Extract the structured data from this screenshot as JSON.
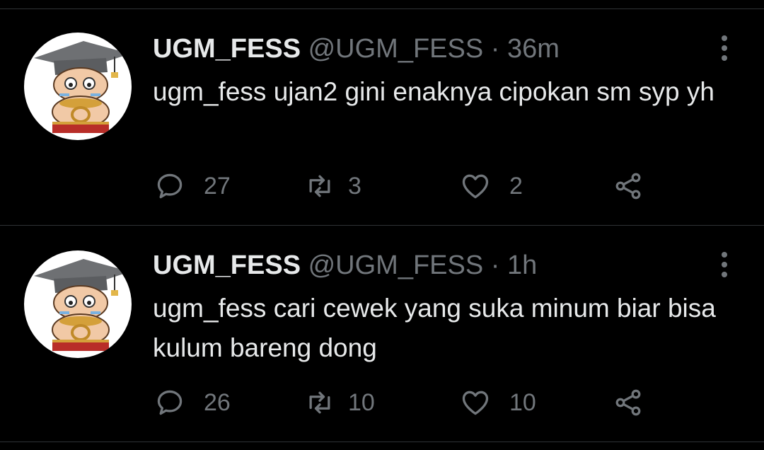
{
  "tweets": [
    {
      "display_name": "UGM_FESS",
      "handle": "@UGM_FESS",
      "separator": "·",
      "time": "36m",
      "text": "ugm_fess ujan2 gini enaknya cipokan sm syp yh",
      "replies": "27",
      "retweets": "3",
      "likes": "2"
    },
    {
      "display_name": "UGM_FESS",
      "handle": "@UGM_FESS",
      "separator": "·",
      "time": "1h",
      "text": "ugm_fess cari cewek yang suka minum biar bisa kulum bareng dong",
      "replies": "26",
      "retweets": "10",
      "likes": "10"
    }
  ],
  "icons": {
    "reply": "reply-icon",
    "retweet": "retweet-icon",
    "like": "heart-icon",
    "share": "share-icon",
    "more": "more-vertical-icon"
  },
  "colors": {
    "background": "#000000",
    "primary_text": "#e7e9ea",
    "secondary_text": "#71767b",
    "divider": "#2f3336"
  }
}
